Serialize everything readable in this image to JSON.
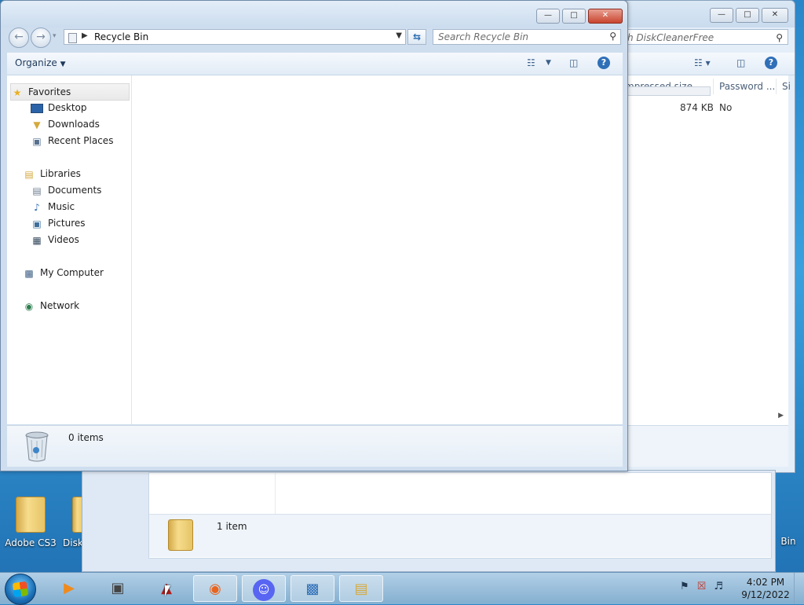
{
  "back_window": {
    "search_text": "h DiskCleanerFree",
    "columns": [
      "mpressed size",
      "Password ...",
      "Si"
    ],
    "row": {
      "size": "874 KB",
      "password": "No"
    }
  },
  "middle_window": {
    "status_text": "1 item"
  },
  "desktop_icons": [
    {
      "label": "Adobe CS3"
    },
    {
      "label": "Disk"
    },
    {
      "label": "Bin"
    }
  ],
  "main_window": {
    "address": "Recycle Bin",
    "search_placeholder": "Search Recycle Bin",
    "toolbar": {
      "organize_label": "Organize"
    },
    "nav": {
      "favorites": "Favorites",
      "desktop": "Desktop",
      "downloads": "Downloads",
      "recent_places": "Recent Places",
      "libraries": "Libraries",
      "documents": "Documents",
      "music": "Music",
      "pictures": "Pictures",
      "videos": "Videos",
      "my_computer": "My Computer",
      "network": "Network"
    },
    "details": {
      "count_text": "0 items"
    }
  },
  "taskbar": {
    "time": "4:02 PM",
    "date": "9/12/2022",
    "apps": [
      "media-player-icon",
      "app-window-icon",
      "red-app-icon",
      "firefox-icon",
      "discord-icon",
      "control-panel-icon",
      "file-explorer-icon"
    ]
  },
  "colors": {
    "accent": "#2f6fb7",
    "close_button": "#c9452f",
    "taskbar": "#a9c6de"
  }
}
